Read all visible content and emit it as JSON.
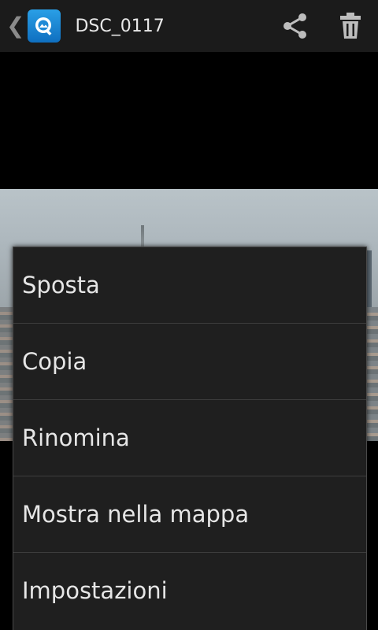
{
  "action_bar": {
    "title": "DSC_0117",
    "back_chevron": "❮",
    "app_icon": "gallery-app-icon",
    "share_icon": "share-icon",
    "delete_icon": "trash-icon"
  },
  "photo": {
    "description_icon": "photo-content"
  },
  "menu": {
    "items": [
      {
        "label": "Sposta"
      },
      {
        "label": "Copia"
      },
      {
        "label": "Rinomina"
      },
      {
        "label": "Mostra nella mappa"
      },
      {
        "label": "Impostazioni"
      }
    ]
  },
  "colors": {
    "action_bar_bg": "#1b1b1b",
    "menu_bg": "#1f1f1f",
    "menu_text": "#e6e6e6",
    "app_icon_blue": "#1f8ad6"
  }
}
